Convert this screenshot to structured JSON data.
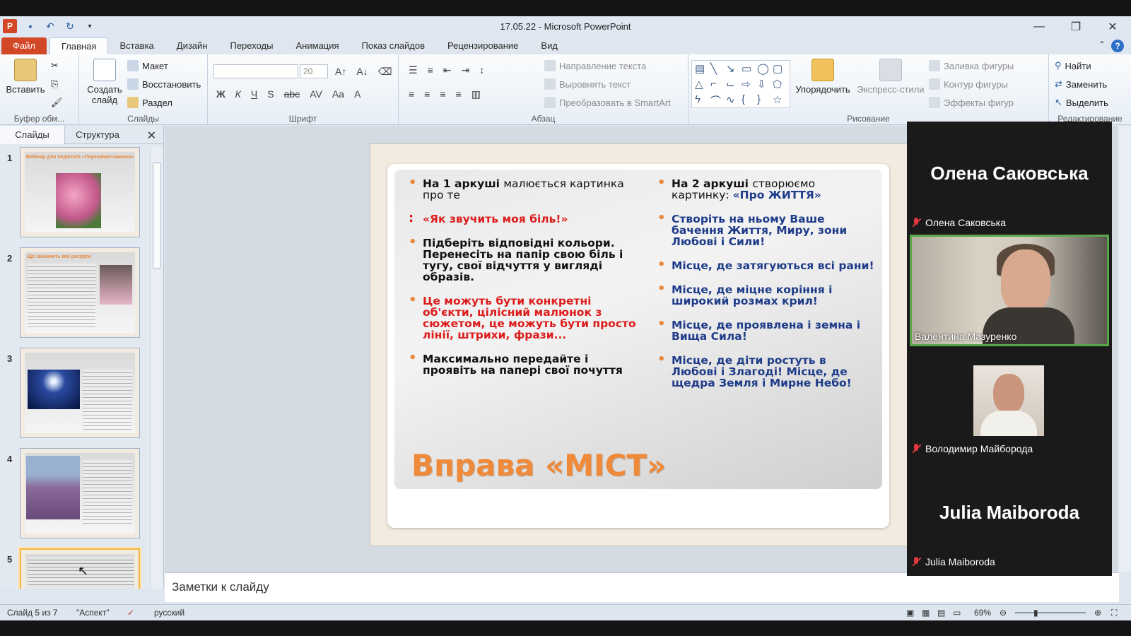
{
  "window": {
    "title": "17.05.22 - Microsoft PowerPoint",
    "app_badge": "P"
  },
  "tabs": {
    "file": "Файл",
    "items": [
      "Главная",
      "Вставка",
      "Дизайн",
      "Переходы",
      "Анимация",
      "Показ слайдов",
      "Рецензирование",
      "Вид"
    ],
    "active": "Главная"
  },
  "ribbon": {
    "clipboard": {
      "paste": "Вставить",
      "label": "Буфер обм..."
    },
    "slides": {
      "new_slide_1": "Создать",
      "new_slide_2": "слайд",
      "layout": "Макет",
      "reset": "Восстановить",
      "section": "Раздел",
      "label": "Слайды"
    },
    "font": {
      "size": "20",
      "label": "Шрифт"
    },
    "paragraph": {
      "text_direction": "Направление текста",
      "align_text": "Выровнять текст",
      "smartart": "Преобразовать в SmartArt",
      "label": "Абзац"
    },
    "drawing": {
      "arrange": "Упорядочить",
      "quick_styles": "Экспресс-стили",
      "fill": "Заливка фигуры",
      "outline": "Контур фигуры",
      "effects": "Эффекты фигур",
      "label": "Рисование"
    },
    "editing": {
      "find": "Найти",
      "replace": "Заменить",
      "select": "Выделить",
      "label": "Редактирование"
    }
  },
  "left_panel": {
    "tab_slides": "Слайды",
    "tab_outline": "Структура",
    "thumbnails": [
      {
        "num": "1",
        "title": "Вебінар для педагогів «Перезавантаження»"
      },
      {
        "num": "2",
        "title": "Що змінюють мої ресурси"
      },
      {
        "num": "3",
        "title": ""
      },
      {
        "num": "4",
        "title": ""
      },
      {
        "num": "5",
        "title": ""
      }
    ],
    "selected": "5"
  },
  "slide": {
    "left_column": [
      {
        "parts": [
          {
            "t": "На 1 аркуші ",
            "c": "blk"
          },
          {
            "t": "малюється картинка про те",
            "c": "blk",
            "n": true
          }
        ]
      },
      {
        "parts": [
          {
            "t": " «Як звучить моя біль!»",
            "c": "red"
          }
        ],
        "colon": true
      },
      {
        "parts": [
          {
            "t": "Підберіть відповідні кольори. Перенесіть на папір свою біль і тугу, свої відчуття у вигляді образів.",
            "c": "blk"
          }
        ]
      },
      {
        "parts": [
          {
            "t": " Це можуть бути конкретні об'єкти, цілісний малюнок з сюжетом, це можуть бути просто лінії, штрихи, фрази...",
            "c": "red"
          }
        ]
      },
      {
        "parts": [
          {
            "t": "Максимально передайте і проявіть на папері свої почуття",
            "c": "blk"
          }
        ]
      }
    ],
    "right_column": [
      {
        "parts": [
          {
            "t": "На 2 аркуші ",
            "c": "blk"
          },
          {
            "t": "створюємо картинку: ",
            "c": "blk",
            "n": true
          },
          {
            "t": "«Про ЖИТТЯ»",
            "c": "blue"
          }
        ]
      },
      {
        "parts": [
          {
            "t": "Створіть на ньому Ваше бачення Життя, Миру, зони Любові і Сили!",
            "c": "blue"
          }
        ]
      },
      {
        "parts": [
          {
            "t": "Місце, де затягуються всі рани!",
            "c": "blue"
          }
        ]
      },
      {
        "parts": [
          {
            "t": "Місце, де міцне коріння і широкий розмах крил!",
            "c": "blue"
          }
        ]
      },
      {
        "parts": [
          {
            "t": "Місце, де проявлена і земна і Вища Сила!",
            "c": "blue"
          }
        ]
      },
      {
        "parts": [
          {
            "t": "Місце, де діти ростуть в Любові і Злагоді! Місце, де щедра Земля і Мирне Небо!",
            "c": "blue"
          }
        ]
      }
    ],
    "title": "Вправа «МІСТ»"
  },
  "notes": {
    "placeholder": "Заметки к слайду"
  },
  "status": {
    "slide_counter": "Слайд 5 из 7",
    "theme": "\"Аспект\"",
    "language": "русский",
    "zoom": "69%"
  },
  "participants": [
    {
      "big_name": "Олена Саковська",
      "label": "Олена Саковська",
      "muted": true,
      "video": false
    },
    {
      "big_name": "",
      "label": "Валентина Мазуренко",
      "muted": false,
      "video": true,
      "active_speaker": true
    },
    {
      "big_name": "",
      "label": "Володимир Майборода",
      "muted": true,
      "video": false,
      "photo": true
    },
    {
      "big_name": "Julia Maiboroda",
      "label": "Julia Maiboroda",
      "muted": true,
      "video": false
    }
  ],
  "colors": {
    "accent_orange": "#ef8a3a",
    "file_tab": "#d24726",
    "speaker_border": "#5aa64a"
  }
}
